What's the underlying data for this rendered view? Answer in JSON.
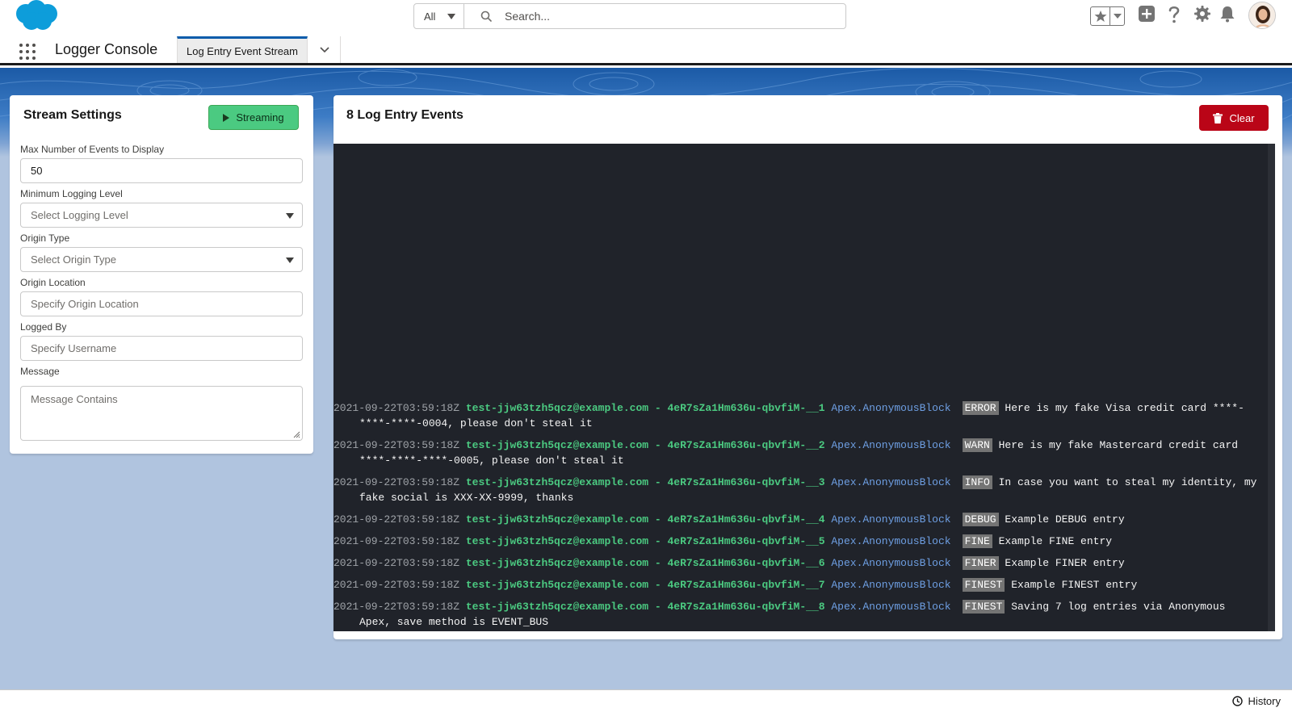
{
  "header": {
    "search_scope": "All",
    "search_placeholder": "Search..."
  },
  "app_nav": {
    "app_name": "Logger Console",
    "active_tab": "Log Entry Event Stream"
  },
  "settings": {
    "title": "Stream Settings",
    "streaming_label": "Streaming",
    "fields": {
      "max_events_label": "Max Number of Events to Display",
      "max_events_value": "50",
      "min_level_label": "Minimum Logging Level",
      "min_level_placeholder": "Select Logging Level",
      "origin_type_label": "Origin Type",
      "origin_type_placeholder": "Select Origin Type",
      "origin_location_label": "Origin Location",
      "origin_location_placeholder": "Specify Origin Location",
      "logged_by_label": "Logged By",
      "logged_by_placeholder": "Specify Username",
      "message_label": "Message",
      "message_placeholder": "Message Contains"
    }
  },
  "events": {
    "title": "8 Log Entry Events",
    "clear_label": "Clear",
    "entries": [
      {
        "timestamp": "2021-09-22T03:59:18Z",
        "user": "test-jjw63tzh5qcz@example.com",
        "transaction": "- 4eR7sZa1Hm636u-qbvfiM-__1",
        "origin": "Apex.AnonymousBlock",
        "level": "ERROR",
        "message": "Here is my fake Visa credit card ****-****-****-0004, please don't steal it"
      },
      {
        "timestamp": "2021-09-22T03:59:18Z",
        "user": "test-jjw63tzh5qcz@example.com",
        "transaction": "- 4eR7sZa1Hm636u-qbvfiM-__2",
        "origin": "Apex.AnonymousBlock",
        "level": "WARN",
        "message": "Here is my fake Mastercard credit card ****-****-****-0005, please don't steal it"
      },
      {
        "timestamp": "2021-09-22T03:59:18Z",
        "user": "test-jjw63tzh5qcz@example.com",
        "transaction": "- 4eR7sZa1Hm636u-qbvfiM-__3",
        "origin": "Apex.AnonymousBlock",
        "level": "INFO",
        "message": "In case you want to steal my identity, my fake social is XXX-XX-9999, thanks"
      },
      {
        "timestamp": "2021-09-22T03:59:18Z",
        "user": "test-jjw63tzh5qcz@example.com",
        "transaction": "- 4eR7sZa1Hm636u-qbvfiM-__4",
        "origin": "Apex.AnonymousBlock",
        "level": "DEBUG",
        "message": "Example DEBUG entry"
      },
      {
        "timestamp": "2021-09-22T03:59:18Z",
        "user": "test-jjw63tzh5qcz@example.com",
        "transaction": "- 4eR7sZa1Hm636u-qbvfiM-__5",
        "origin": "Apex.AnonymousBlock",
        "level": "FINE",
        "message": "Example FINE entry"
      },
      {
        "timestamp": "2021-09-22T03:59:18Z",
        "user": "test-jjw63tzh5qcz@example.com",
        "transaction": "- 4eR7sZa1Hm636u-qbvfiM-__6",
        "origin": "Apex.AnonymousBlock",
        "level": "FINER",
        "message": "Example FINER entry"
      },
      {
        "timestamp": "2021-09-22T03:59:18Z",
        "user": "test-jjw63tzh5qcz@example.com",
        "transaction": "- 4eR7sZa1Hm636u-qbvfiM-__7",
        "origin": "Apex.AnonymousBlock",
        "level": "FINEST",
        "message": "Example FINEST entry"
      },
      {
        "timestamp": "2021-09-22T03:59:18Z",
        "user": "test-jjw63tzh5qcz@example.com",
        "transaction": "- 4eR7sZa1Hm636u-qbvfiM-__8",
        "origin": "Apex.AnonymousBlock",
        "level": "FINEST",
        "message": "Saving 7 log entries via Anonymous Apex, save method is EVENT_BUS"
      }
    ]
  },
  "utility_bar": {
    "history_label": "History"
  },
  "icons": {
    "logo": "salesforce-cloud-icon",
    "search": "search-icon",
    "favorites": "star-icon",
    "global_actions": "plus-icon",
    "help": "question-icon",
    "setup": "gear-icon",
    "notifications": "bell-icon",
    "app_launcher": "waffle-icon",
    "history": "clock-icon",
    "clear": "trash-icon",
    "streaming": "play-icon"
  },
  "colors": {
    "brand_blue": "#0b5cab",
    "streaming_green": "#4bca81",
    "clear_red": "#ba0517",
    "console_bg": "#20232a",
    "log_user_green": "#4bca81",
    "log_origin_blue": "#6e9fe3",
    "level_badge": "#747474"
  }
}
